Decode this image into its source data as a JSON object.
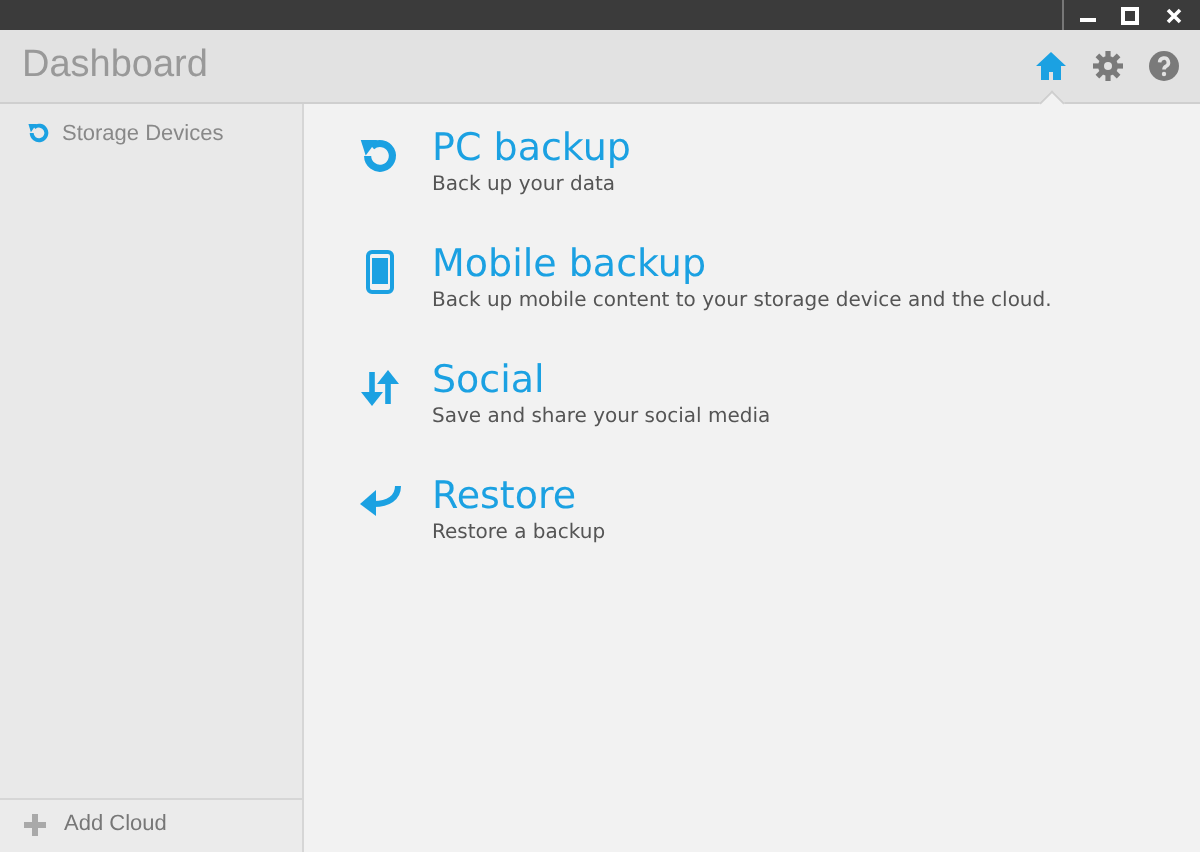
{
  "window": {
    "title": "Dashboard"
  },
  "nav": [
    {
      "kind": "home",
      "selected": true
    },
    {
      "kind": "settings",
      "selected": false
    },
    {
      "kind": "help",
      "selected": false
    }
  ],
  "sidebar": {
    "items": [
      {
        "label": "Storage Devices"
      }
    ],
    "footer": {
      "label": "Add Cloud"
    }
  },
  "actions": [
    {
      "kind": "pc",
      "title": "PC backup",
      "subtitle": "Back up your data"
    },
    {
      "kind": "mobile",
      "title": "Mobile backup",
      "subtitle": "Back up mobile content to your storage device and the cloud."
    },
    {
      "kind": "social",
      "title": "Social",
      "subtitle": "Save and share your social media"
    },
    {
      "kind": "restore",
      "title": "Restore",
      "subtitle": "Restore a backup"
    }
  ]
}
